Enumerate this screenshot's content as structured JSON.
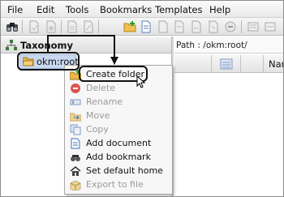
{
  "menubar": {
    "items": [
      "File",
      "Edit",
      "Tools",
      "Bookmarks",
      "Templates",
      "Help"
    ]
  },
  "toolbar": {
    "icons": [
      "binoculars-icon",
      "document-icon",
      "document-icon",
      "document-icon",
      "document-icon",
      "folder-add-icon",
      "document-add-icon",
      "document-icon",
      "document-icon",
      "document-icon",
      "document-icon",
      "document-icon",
      "document-icon"
    ]
  },
  "tree": {
    "title": "Taxonomy",
    "root_label": "okm:root"
  },
  "path": {
    "text": "Path : /okm:root/"
  },
  "list": {
    "name_header": "Nam"
  },
  "context_menu": {
    "items": [
      {
        "label": "Create folder",
        "icon": "folder-add-icon",
        "enabled": true
      },
      {
        "label": "Delete",
        "icon": "delete-icon",
        "enabled": false
      },
      {
        "label": "Rename",
        "icon": "rename-icon",
        "enabled": false
      },
      {
        "label": "Move",
        "icon": "move-icon",
        "enabled": false
      },
      {
        "label": "Copy",
        "icon": "copy-icon",
        "enabled": false
      },
      {
        "label": "Add document",
        "icon": "add-document-icon",
        "enabled": true
      },
      {
        "label": "Add bookmark",
        "icon": "bookmark-icon",
        "enabled": true
      },
      {
        "label": "Set default home",
        "icon": "home-icon",
        "enabled": true
      },
      {
        "label": "Export to file",
        "icon": "export-icon",
        "enabled": false
      }
    ]
  },
  "colors": {
    "selection": "#c8d8f0",
    "folder": "#e8b84a",
    "delete_red": "#d23b2f"
  }
}
